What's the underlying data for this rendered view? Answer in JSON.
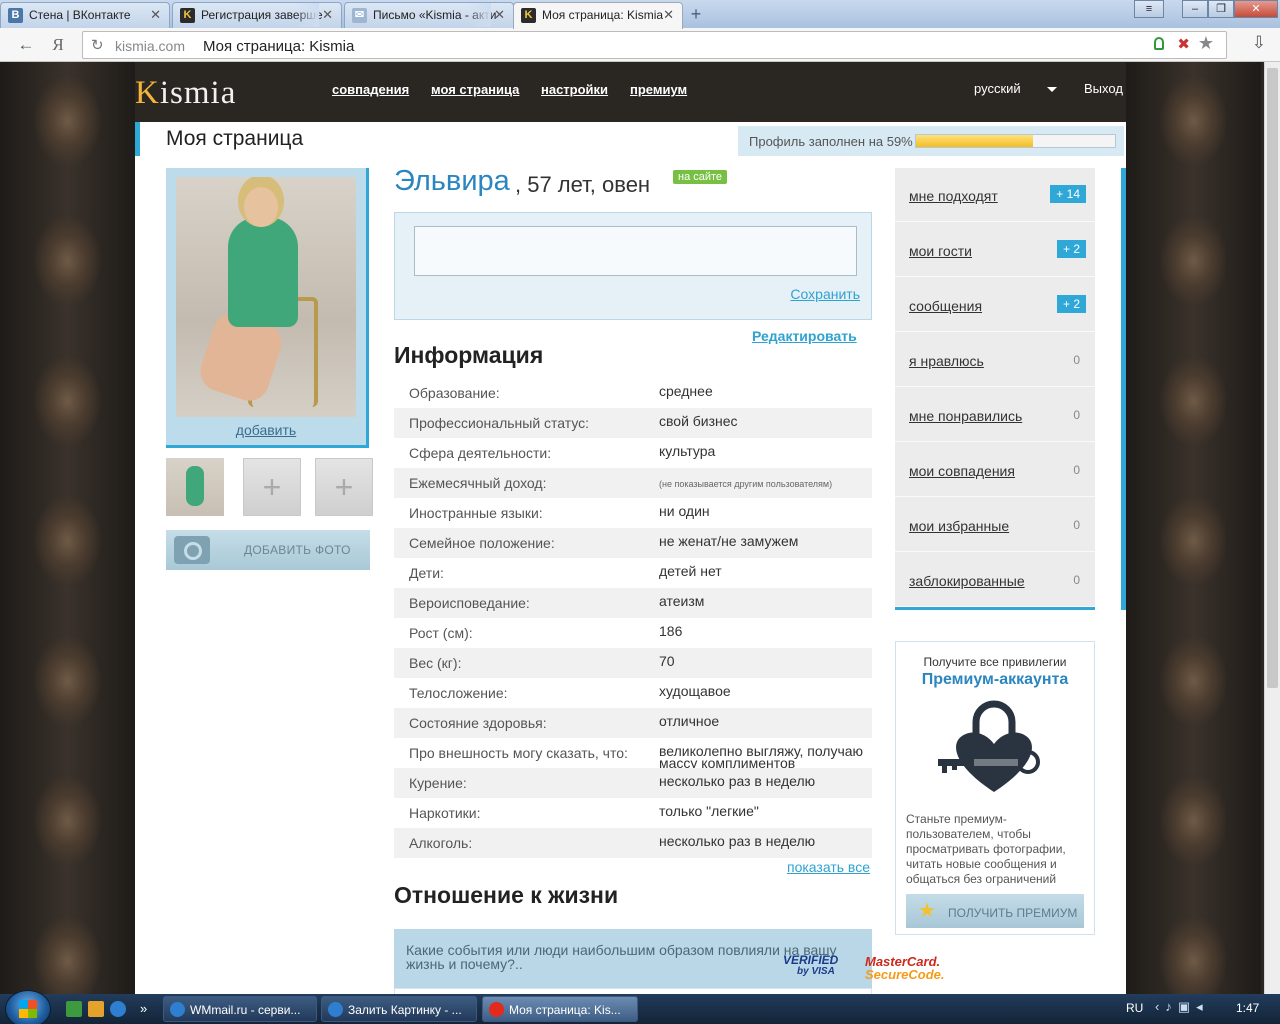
{
  "browser": {
    "tabs": [
      {
        "title": "Стена | ВКонтакте",
        "icon": "vk-icon",
        "active": false
      },
      {
        "title": "Регистрация заверше",
        "icon": "kismia-icon",
        "active": false
      },
      {
        "title": "Письмо «Kismia - акти",
        "icon": "mail-icon",
        "active": false
      },
      {
        "title": "Моя страница: Kismia",
        "icon": "kismia-icon",
        "active": true
      }
    ],
    "address": {
      "domain": "kismia.com",
      "title": "Моя страница: Kismia"
    },
    "yandex_button": "Я"
  },
  "site": {
    "logo": {
      "first": "K",
      "rest": "ismia"
    },
    "nav": [
      "совпадения",
      "моя страница",
      "настройки",
      "премиум"
    ],
    "language": "русский",
    "logout": "Выход"
  },
  "page": {
    "title": "Моя страница",
    "profile_progress": {
      "label": "Профиль заполнен на 59%",
      "percent": 59
    }
  },
  "photos": {
    "add_link": "добавить",
    "add_photo_button": "ДОБАВИТЬ ФОТО"
  },
  "profile": {
    "name": "Эльвира",
    "age_sign": ", 57 лет, овен",
    "online_badge": "на сайте",
    "save_link": "Сохранить",
    "edit_link": "Редактировать",
    "info_title": "Информация",
    "info": [
      {
        "key": "Образование:",
        "value": "среднее"
      },
      {
        "key": "Профессиональный статус:",
        "value": "свой бизнес"
      },
      {
        "key": "Сфера деятельности:",
        "value": "культура"
      },
      {
        "key": "Ежемесячный доход:",
        "value": "(не показывается другим пользователям)",
        "small": true
      },
      {
        "key": "Иностранные языки:",
        "value": "ни один"
      },
      {
        "key": "Семейное положение:",
        "value": "не женат/не замужем"
      },
      {
        "key": "Дети:",
        "value": "детей нет"
      },
      {
        "key": "Вероисповедание:",
        "value": "атеизм"
      },
      {
        "key": "Рост (см):",
        "value": "186"
      },
      {
        "key": "Вес (кг):",
        "value": "70"
      },
      {
        "key": "Телосложение:",
        "value": "худощавое"
      },
      {
        "key": "Состояние здоровья:",
        "value": "отличное"
      },
      {
        "key": "Про внешность могу сказать, что:",
        "value": "великолепно выгляжу, получаю массу комплиментов"
      },
      {
        "key": "Курение:",
        "value": "несколько раз в неделю"
      },
      {
        "key": "Наркотики:",
        "value": "только \"легкие\""
      },
      {
        "key": "Алкоголь:",
        "value": "несколько раз в неделю"
      }
    ],
    "show_all": "показать все",
    "life_title": "Отношение к жизни",
    "life_question": "Какие события или люди наибольшим образом повлияли на вашу жизнь и почему?.."
  },
  "counters": [
    {
      "label": "мне подходят",
      "count": "+ 14",
      "highlight": true
    },
    {
      "label": "мои гости",
      "count": "+ 2",
      "highlight": true
    },
    {
      "label": "сообщения",
      "count": "+ 2",
      "highlight": true
    },
    {
      "label": "я нравлюсь",
      "count": "0",
      "highlight": false
    },
    {
      "label": "мне понравились",
      "count": "0",
      "highlight": false
    },
    {
      "label": "мои совпадения",
      "count": "0",
      "highlight": false
    },
    {
      "label": "мои избранные",
      "count": "0",
      "highlight": false
    },
    {
      "label": "заблокированные",
      "count": "0",
      "highlight": false
    }
  ],
  "premium": {
    "top": "Получите все привилегии",
    "title": "Премиум-аккаунта",
    "description": "Станьте премиум-пользователем, чтобы просматривать фотографии, читать новые сообщения и общаться без ограничений",
    "button": "ПОЛУЧИТЬ ПРЕМИУМ",
    "icon": "heart-lock-key-icon"
  },
  "payment": {
    "visa_line1": "VERIFIED",
    "visa_line2": "by VISA",
    "mc_line1": "MasterCard.",
    "mc_line2": "SecureCode."
  },
  "taskbar": {
    "tasks": [
      {
        "title": "WMmail.ru - серви...",
        "icon": "ie-icon",
        "active": false
      },
      {
        "title": "Залить Картинку - ...",
        "icon": "ie-icon",
        "active": false
      },
      {
        "title": "Моя страница: Kis...",
        "icon": "yandex-browser-icon",
        "active": true
      }
    ],
    "lang": "RU",
    "clock": "1:47"
  },
  "colors": {
    "accent": "#2fa8d8",
    "link": "#2b86c0",
    "online": "#77c043",
    "progress": "#f4bd24"
  }
}
